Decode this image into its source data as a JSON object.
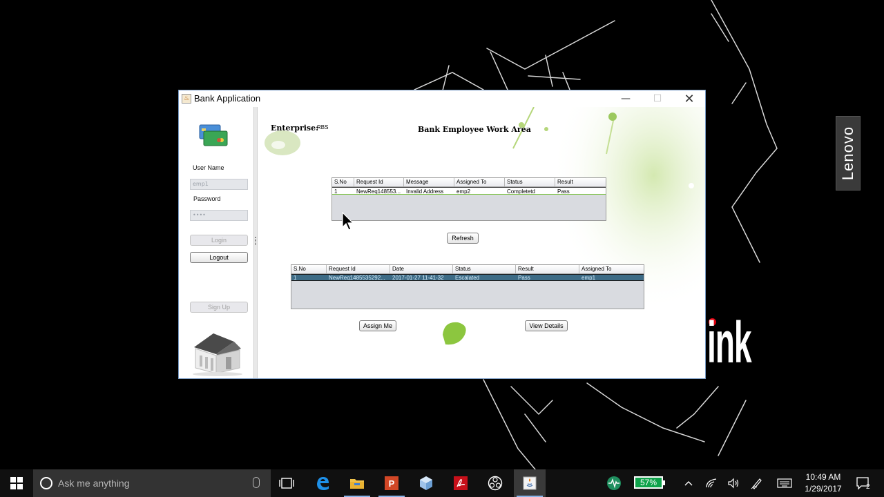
{
  "window": {
    "title": "Bank Application",
    "minimize_glyph": "—",
    "maximize_glyph": "☐",
    "close_glyph": "✕"
  },
  "login_panel": {
    "username_label": "User Name",
    "username_value": "emp1",
    "password_label": "Password",
    "password_value": "••••",
    "login_label": "Login",
    "logout_label": "Logout",
    "signup_label": "Sign Up"
  },
  "work_area": {
    "enterprise_label": "Enterprise:",
    "enterprise_value": "RBS",
    "title": "Bank Employee Work Area",
    "refresh_label": "Refresh",
    "assign_me_label": "Assign Me",
    "view_details_label": "View Details"
  },
  "requests_table": {
    "columns": [
      "S.No",
      "Request Id",
      "Message",
      "Assigned To",
      "Status",
      "Result"
    ],
    "rows": [
      [
        "1",
        "NewReq148553...",
        "Invalid Address",
        "emp2",
        "Completetd",
        "Pass"
      ]
    ]
  },
  "work_table": {
    "columns": [
      "S.No",
      "Request Id",
      "Date",
      "Status",
      "Result",
      "Assigned To"
    ],
    "rows": [
      [
        "1",
        "NewReq1485535292...",
        "2017-01-27 11-41-32",
        "Escalated",
        "Pass",
        "emp1"
      ]
    ]
  },
  "desktop": {
    "side_tag": "Lenovo",
    "brand_fragment": "ink"
  },
  "taskbar": {
    "search_placeholder": "Ask me anything",
    "battery": "57%",
    "time": "10:49 AM",
    "date": "1/29/2017",
    "notification_count": "2",
    "apps": [
      "task-view",
      "edge",
      "file-explorer",
      "powerpoint",
      "virtualbox",
      "acrobat",
      "obs",
      "java"
    ]
  },
  "colors": {
    "selection": "#3d6b86",
    "accent_green": "#7ac143",
    "battery": "#0fa34b"
  }
}
